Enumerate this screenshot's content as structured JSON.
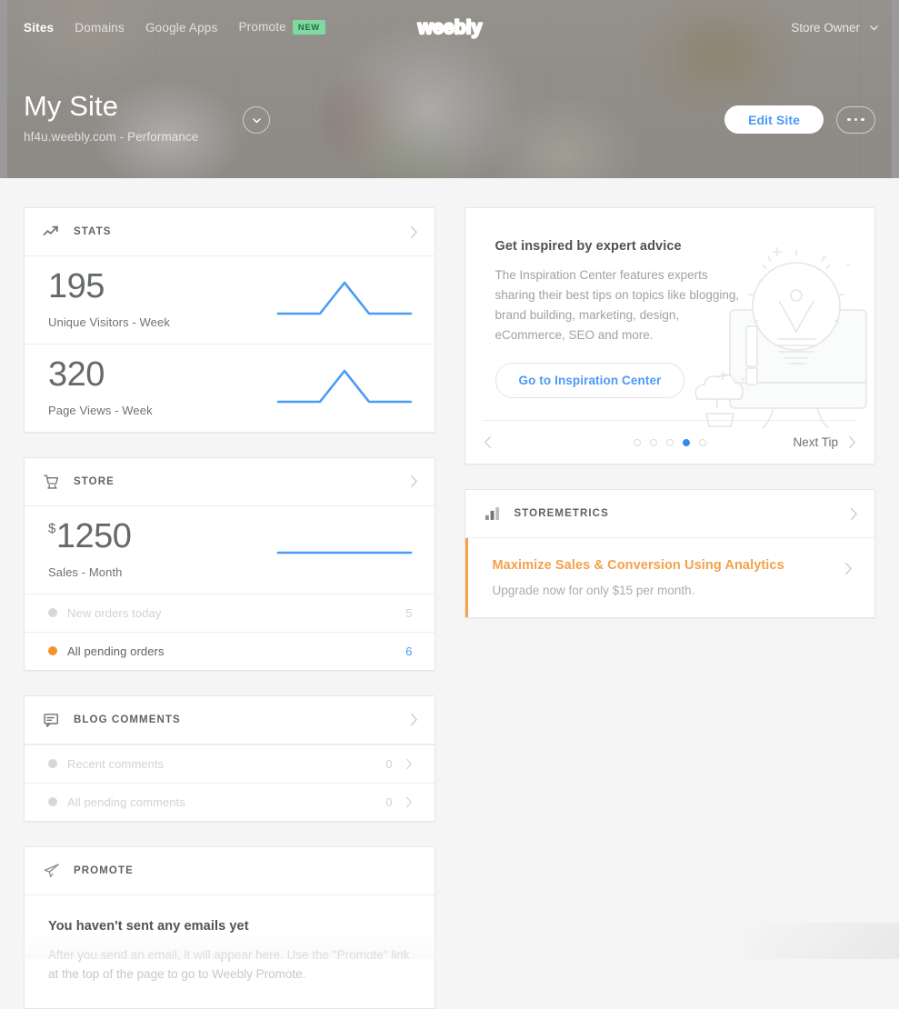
{
  "topnav": {
    "items": [
      {
        "label": "Sites",
        "active": true,
        "badge": null
      },
      {
        "label": "Domains",
        "active": false,
        "badge": null
      },
      {
        "label": "Google Apps",
        "active": false,
        "badge": null
      },
      {
        "label": "Promote",
        "active": false,
        "badge": "NEW"
      }
    ],
    "brand": "weebly",
    "user": "Store Owner",
    "user_caret_icon": "chevron-down-icon"
  },
  "hero": {
    "site_title": "My Site",
    "site_url": "hf4u.weebly.com - Performance",
    "dropdown_icon": "chevron-down-icon",
    "edit_button": "Edit Site",
    "more_button_icon": "ellipsis-icon"
  },
  "stats_card": {
    "icon": "trending-up-icon",
    "title": "STATS",
    "chevron_icon": "chevron-right-icon",
    "rows": [
      {
        "value": "195",
        "label": "Unique Visitors - Week"
      },
      {
        "value": "320",
        "label": "Page Views - Week"
      }
    ]
  },
  "store_card": {
    "icon": "shopping-cart-icon",
    "title": "STORE",
    "chevron_icon": "chevron-right-icon",
    "currency": "$",
    "value": "1250",
    "label": "Sales - Month",
    "rows": [
      {
        "label": "New orders today",
        "value": "5",
        "state": "muted",
        "dot_color": "#d5d8da"
      },
      {
        "label": "All pending orders",
        "value": "6",
        "state": "active",
        "dot_color": "#f5922e"
      }
    ]
  },
  "blog_card": {
    "icon": "comment-icon",
    "title": "BLOG COMMENTS",
    "chevron_icon": "chevron-right-icon",
    "rows": [
      {
        "label": "Recent comments",
        "value": "0",
        "state": "muted",
        "dot_color": "#d5d8da"
      },
      {
        "label": "All pending comments",
        "value": "0",
        "state": "muted",
        "dot_color": "#d5d8da"
      }
    ]
  },
  "promote_card": {
    "icon": "paper-plane-icon",
    "title": "PROMOTE",
    "heading": "You haven't sent any emails yet",
    "body": "After you send an email, it will appear here. Use the \"Promote\" link at the top of the page to go to Weebly Promote."
  },
  "inspiration_card": {
    "heading": "Get inspired by expert advice",
    "body": "The Inspiration Center features experts sharing their best tips on topics like blogging, brand building, marketing, design, eCommerce, SEO and more.",
    "cta": "Go to Inspiration Center",
    "prev_icon": "chevron-left-icon",
    "next_icon": "chevron-right-icon",
    "next_label": "Next Tip",
    "dots_total": 5,
    "dots_active_index": 3,
    "illustration": "lightbulb-monitor-icon"
  },
  "storemetrics_card": {
    "icon": "bar-chart-icon",
    "title": "STOREMETRICS",
    "chevron_icon": "chevron-right-icon",
    "promo_heading": "Maximize Sales & Conversion Using Analytics",
    "promo_body": "Upgrade now for only $15 per month.",
    "promo_chevron_icon": "chevron-right-icon"
  },
  "colors": {
    "accent_blue": "#4a9bf5",
    "sparkline_blue": "#4a9bf5",
    "accent_orange": "#f5a04a",
    "pending_dot_orange": "#f5922e",
    "badge_green": "#7ddaa0",
    "page_bg": "#f5f5f5",
    "dot_active_blue": "#2f8eef"
  },
  "chart_data": [
    {
      "type": "line",
      "title": "Unique Visitors - Week",
      "x": [
        0,
        1,
        2,
        3,
        4,
        5,
        6
      ],
      "values": [
        10,
        10,
        10,
        62,
        10,
        10,
        10
      ],
      "ylim": [
        0,
        70
      ],
      "grid": false,
      "legend": "none"
    },
    {
      "type": "line",
      "title": "Page Views - Week",
      "x": [
        0,
        1,
        2,
        3,
        4,
        5,
        6
      ],
      "values": [
        10,
        10,
        10,
        62,
        10,
        10,
        10
      ],
      "ylim": [
        0,
        70
      ],
      "grid": false,
      "legend": "none"
    },
    {
      "type": "line",
      "title": "Sales - Month",
      "x": [
        0,
        1,
        2,
        3,
        4,
        5,
        6
      ],
      "values": [
        10,
        10,
        10,
        10,
        10,
        10,
        10
      ],
      "ylim": [
        0,
        70
      ],
      "grid": false,
      "legend": "none"
    }
  ]
}
